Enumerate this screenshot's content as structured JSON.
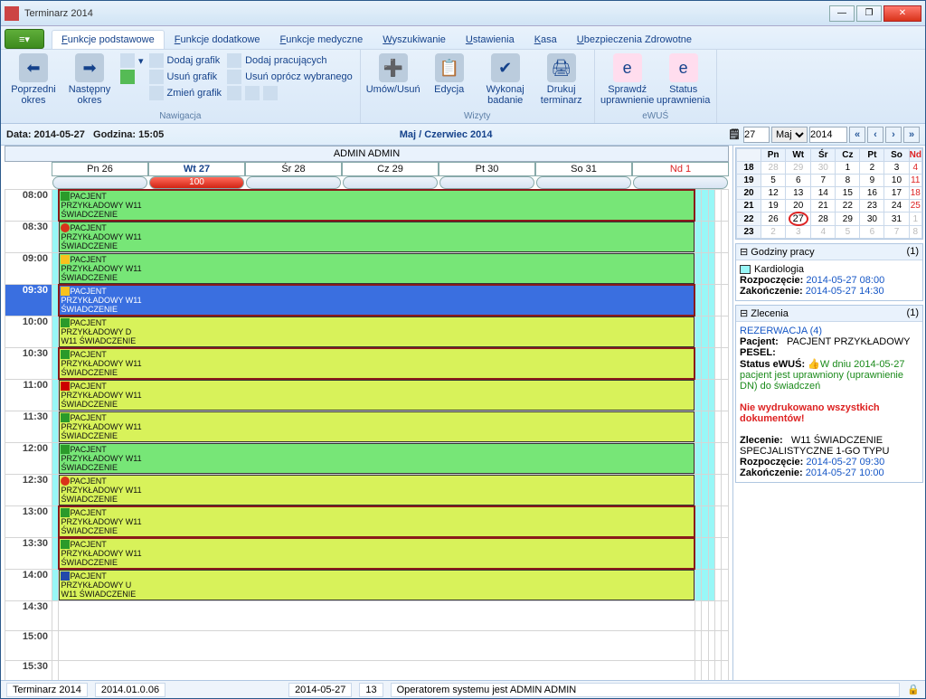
{
  "window": {
    "title": "Terminarz 2014"
  },
  "tabs": {
    "active": "Funkcje podstawowe",
    "items": [
      "Funkcje podstawowe",
      "Funkcje dodatkowe",
      "Funkcje medyczne",
      "Wyszukiwanie",
      "Ustawienia",
      "Kasa",
      "Ubezpieczenia Zdrowotne"
    ]
  },
  "ribbon": {
    "nawigacja": {
      "label": "Nawigacja",
      "prev": "Poprzedni okres",
      "next": "Następny okres",
      "dodaj_grafik": "Dodaj grafik",
      "usun_grafik": "Usuń grafik",
      "zmien_grafik": "Zmień grafik",
      "dodaj_prac": "Dodaj pracujących",
      "usun_oprocz": "Usuń oprócz wybranego"
    },
    "wizyty": {
      "label": "Wizyty",
      "umow": "Umów/Usuń",
      "edycja": "Edycja",
      "wykonaj": "Wykonaj badanie",
      "drukuj": "Drukuj terminarz"
    },
    "ewus": {
      "label": "eWUŚ",
      "sprawdz": "Sprawdź uprawnienie",
      "status": "Status uprawnienia"
    }
  },
  "datebar": {
    "data": "Data: 2014-05-27",
    "godzina": "Godzina: 15:05",
    "period": "Maj / Czerwiec 2014",
    "day": "27",
    "month": "Maj",
    "year": "2014"
  },
  "cal": {
    "admin": "ADMIN ADMIN",
    "days": [
      "Pn 26",
      "Wt 27",
      "Śr 28",
      "Cz 29",
      "Pt 30",
      "So 31",
      "Nd 1"
    ],
    "today_cap": "100",
    "times": [
      "08:00",
      "08:30",
      "09:00",
      "09:30",
      "10:00",
      "10:30",
      "11:00",
      "11:30",
      "12:00",
      "12:30",
      "13:00",
      "13:30",
      "14:00",
      "14:30",
      "15:00",
      "15:30"
    ],
    "appts": [
      {
        "t": "08:00",
        "cls": "g hl",
        "ic": "ok",
        "l1": "PACJENT",
        "l2": "PRZYKŁADOWY W11",
        "l3": "ŚWIADCZENIE"
      },
      {
        "t": "08:30",
        "cls": "g",
        "ic": "no",
        "l1": "PACJENT",
        "l2": "PRZYKŁADOWY W11",
        "l3": "ŚWIADCZENIE"
      },
      {
        "t": "09:00",
        "cls": "g",
        "ic": "warn",
        "l1": "PACJENT",
        "l2": "PRZYKŁADOWY W11",
        "l3": "ŚWIADCZENIE"
      },
      {
        "t": "09:30",
        "cls": "b hl",
        "ic": "warn",
        "l1": "PACJENT",
        "l2": "PRZYKŁADOWY W11",
        "l3": "ŚWIADCZENIE"
      },
      {
        "t": "10:00",
        "cls": "y",
        "ic": "ok",
        "l1": "PACJENT",
        "l2": "PRZYKŁADOWY D",
        "l3": "W11 ŚWIADCZENIE"
      },
      {
        "t": "10:30",
        "cls": "y hl",
        "ic": "ok",
        "l1": "PACJENT",
        "l2": "PRZYKŁADOWY W11",
        "l3": "ŚWIADCZENIE"
      },
      {
        "t": "11:00",
        "cls": "y",
        "ic": "x",
        "l1": "PACJENT",
        "l2": "PRZYKŁADOWY W11",
        "l3": "ŚWIADCZENIE"
      },
      {
        "t": "11:30",
        "cls": "y",
        "ic": "ok",
        "l1": "PACJENT",
        "l2": "PRZYKŁADOWY W11",
        "l3": "ŚWIADCZENIE"
      },
      {
        "t": "12:00",
        "cls": "g",
        "ic": "ok",
        "l1": "PACJENT",
        "l2": "PRZYKŁADOWY W11",
        "l3": "ŚWIADCZENIE"
      },
      {
        "t": "12:30",
        "cls": "y",
        "ic": "no",
        "l1": "PACJENT",
        "l2": "PRZYKŁADOWY W11",
        "l3": "ŚWIADCZENIE"
      },
      {
        "t": "13:00",
        "cls": "y hl",
        "ic": "ok",
        "l1": "PACJENT",
        "l2": "PRZYKŁADOWY W11",
        "l3": "ŚWIADCZENIE"
      },
      {
        "t": "13:30",
        "cls": "y hl",
        "ic": "ok",
        "l1": "PACJENT",
        "l2": "PRZYKŁADOWY W11",
        "l3": "ŚWIADCZENIE"
      },
      {
        "t": "14:00",
        "cls": "y",
        "ic": "eu",
        "l1": "PACJENT",
        "l2": "PRZYKŁADOWY U",
        "l3": "W11 ŚWIADCZENIE"
      }
    ]
  },
  "mini": {
    "hdr": [
      "Pn",
      "Wt",
      "Śr",
      "Cz",
      "Pt",
      "So",
      "Nd"
    ],
    "rows": [
      {
        "wk": "18",
        "d": [
          "28",
          "29",
          "30",
          "1",
          "2",
          "3",
          "4"
        ],
        "dim": [
          0,
          1,
          2
        ]
      },
      {
        "wk": "19",
        "d": [
          "5",
          "6",
          "7",
          "8",
          "9",
          "10",
          "11"
        ],
        "dim": []
      },
      {
        "wk": "20",
        "d": [
          "12",
          "13",
          "14",
          "15",
          "16",
          "17",
          "18"
        ],
        "dim": []
      },
      {
        "wk": "21",
        "d": [
          "19",
          "20",
          "21",
          "22",
          "23",
          "24",
          "25"
        ],
        "dim": []
      },
      {
        "wk": "22",
        "d": [
          "26",
          "27",
          "28",
          "29",
          "30",
          "31",
          "1"
        ],
        "dim": [
          6
        ],
        "today": 1
      },
      {
        "wk": "23",
        "d": [
          "2",
          "3",
          "4",
          "5",
          "6",
          "7",
          "8"
        ],
        "dim": [
          0,
          1,
          2,
          3,
          4,
          5,
          6
        ]
      }
    ]
  },
  "hours": {
    "title": "Godziny pracy",
    "count": "(1)",
    "dept": "Kardiologia",
    "start_l": "Rozpoczęcie:",
    "start_v": "2014-05-27 08:00",
    "end_l": "Zakończenie:",
    "end_v": "2014-05-27 14:30"
  },
  "orders": {
    "title": "Zlecenia",
    "count": "(1)",
    "rez": "REZERWACJA (4)",
    "pac_l": "Pacjent:",
    "pac_v": "PACJENT PRZYKŁADOWY",
    "pesel_l": "PESEL:",
    "pesel_v": "",
    "ewus_l": "Status eWUŚ:",
    "ewus_pre": "W dniu 2014-05-27",
    "ewus_txt": "pacjent jest uprawniony (uprawnienie DN) do świadczeń",
    "warn": "Nie wydrukowano wszystkich dokumentów!",
    "zlec_l": "Zlecenie:",
    "zlec_v": "W11 ŚWIADCZENIE SPECJALISTYCZNE 1-GO TYPU",
    "start_l": "Rozpoczęcie:",
    "start_v": "2014-05-27 09:30",
    "end_l": "Zakończenie:",
    "end_v": "2014-05-27 10:00"
  },
  "status": {
    "app": "Terminarz 2014",
    "ver": "2014.01.0.06",
    "date": "2014-05-27",
    "n": "13",
    "op": "Operatorem systemu jest ADMIN ADMIN"
  }
}
